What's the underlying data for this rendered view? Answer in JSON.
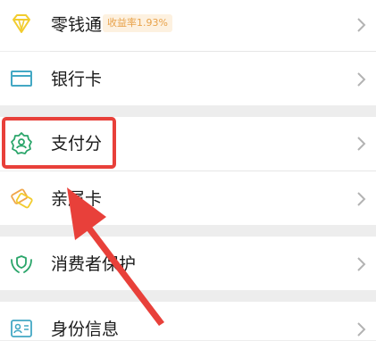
{
  "menu": {
    "items": [
      {
        "label": "零钱通",
        "icon": "diamond-icon",
        "badge": "收益率1.93%"
      },
      {
        "label": "银行卡",
        "icon": "card-icon"
      },
      {
        "label": "支付分",
        "icon": "badge-user-icon"
      },
      {
        "label": "亲属卡",
        "icon": "family-card-icon"
      },
      {
        "label": "消费者保护",
        "icon": "hands-shield-icon"
      },
      {
        "label": "身份信息",
        "icon": "id-card-icon"
      }
    ]
  },
  "colors": {
    "icon_green": "#2aa56a",
    "icon_yellow": "#f2cc2e",
    "icon_teal": "#43a8c4",
    "badge_text": "#e8a24a",
    "highlight": "#e8403a"
  }
}
